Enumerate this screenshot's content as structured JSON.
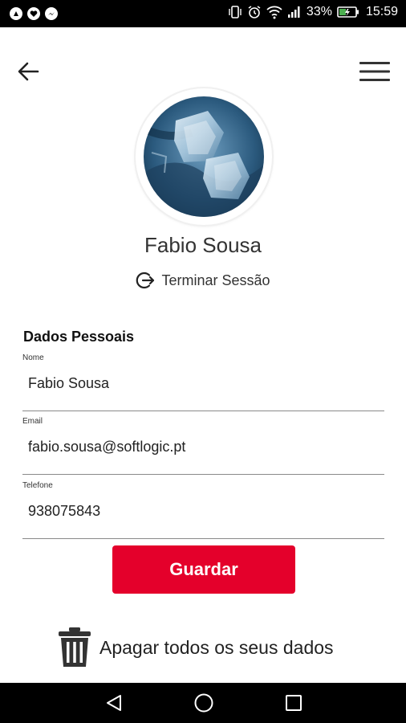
{
  "status_bar": {
    "battery_percent": "33%",
    "time": "15:59",
    "icons": [
      "android-notification-icon",
      "heart-notification-icon",
      "messenger-notification-icon",
      "vibrate-icon",
      "alarm-icon",
      "wifi-icon",
      "signal-icon",
      "battery-charging-icon"
    ]
  },
  "header": {
    "back_icon": "arrow-left-icon",
    "menu_icon": "hamburger-menu-icon"
  },
  "profile": {
    "name": "Fabio Sousa",
    "logout_label": "Terminar Sessão",
    "logout_icon": "logout-icon"
  },
  "form": {
    "section_title": "Dados Pessoais",
    "fields": [
      {
        "label": "Nome",
        "value": "Fabio Sousa"
      },
      {
        "label": "Email",
        "value": "fabio.sousa@softlogic.pt"
      },
      {
        "label": "Telefone",
        "value": "938075843"
      }
    ],
    "save_label": "Guardar"
  },
  "delete": {
    "label": "Apagar todos os seus dados",
    "icon": "trash-icon"
  },
  "nav_bar": {
    "icons": [
      "nav-back-icon",
      "nav-home-icon",
      "nav-recents-icon"
    ]
  },
  "colors": {
    "accent": "#e4002b",
    "status_bar": "#000000",
    "background": "#ffffff"
  }
}
